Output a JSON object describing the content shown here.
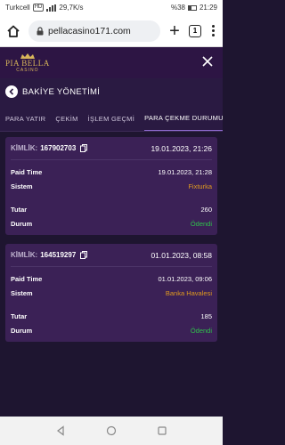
{
  "status_bar": {
    "carrier": "Turkcell",
    "network_badge": "HD",
    "speed": "29,7K/s",
    "battery": "%38",
    "time": "21:29"
  },
  "browser": {
    "url": "pellacasino171.com",
    "tab_count": "1"
  },
  "app": {
    "brand": "PIA BELLA",
    "brand_sub": "CASINO"
  },
  "page": {
    "title": "BAKİYE YÖNETİMİ"
  },
  "tabs": [
    {
      "label": "PARA YATIR",
      "active": false
    },
    {
      "label": "ÇEKİM",
      "active": false
    },
    {
      "label": "İŞLEM GEÇMİ",
      "active": false
    },
    {
      "label": "PARA ÇEKME DURUMU",
      "active": true
    }
  ],
  "labels": {
    "id": "KİMLİK:",
    "paid_time": "Paid Time",
    "system": "Sistem",
    "amount": "Tutar",
    "status": "Durum"
  },
  "transactions": [
    {
      "id": "167902703",
      "date": "19.01.2023, 21:26",
      "paid_time": "19.01.2023, 21:28",
      "system": "Fixturka",
      "amount": "260",
      "status": "Ödendi"
    },
    {
      "id": "164519297",
      "date": "01.01.2023, 08:58",
      "paid_time": "01.01.2023, 09:06",
      "system": "Banka Havalesi",
      "amount": "185",
      "status": "Ödendi"
    }
  ],
  "colors": {
    "accent": "#8f6ad0",
    "system_text": "#e09a1f",
    "paid_status": "#2fc24b",
    "card_bg": "#3b2156"
  }
}
